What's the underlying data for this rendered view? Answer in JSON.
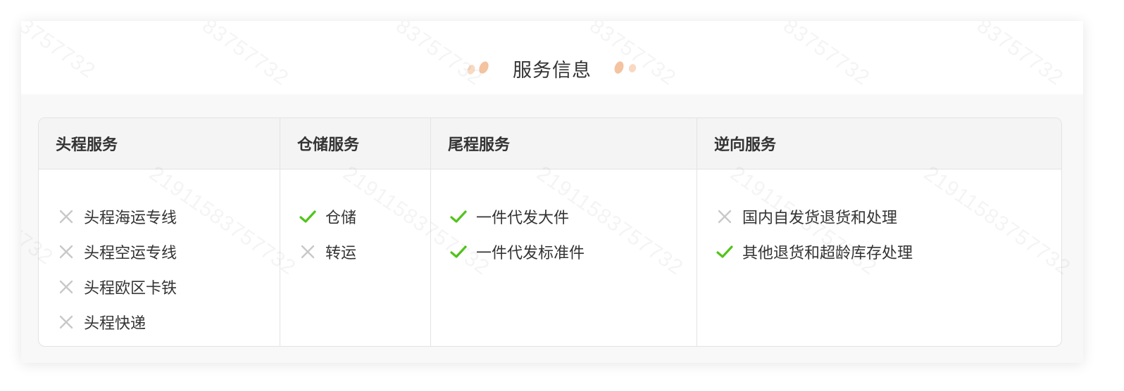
{
  "service_info": {
    "title": "服务信息",
    "columns": [
      {
        "id": "first-leg",
        "header": "头程服务",
        "items": [
          {
            "label": "头程海运专线",
            "status": "unavailable",
            "icon": "cross-icon"
          },
          {
            "label": "头程空运专线",
            "status": "unavailable",
            "icon": "cross-icon"
          },
          {
            "label": "头程欧区卡铁",
            "status": "unavailable",
            "icon": "cross-icon"
          },
          {
            "label": "头程快递",
            "status": "unavailable",
            "icon": "cross-icon"
          }
        ]
      },
      {
        "id": "warehousing",
        "header": "仓储服务",
        "items": [
          {
            "label": "仓储",
            "status": "available",
            "icon": "check-icon"
          },
          {
            "label": "转运",
            "status": "unavailable",
            "icon": "cross-icon"
          }
        ]
      },
      {
        "id": "last-leg",
        "header": "尾程服务",
        "items": [
          {
            "label": "一件代发大件",
            "status": "available",
            "icon": "check-icon"
          },
          {
            "label": "一件代发标准件",
            "status": "available",
            "icon": "check-icon"
          }
        ]
      },
      {
        "id": "reverse",
        "header": "逆向服务",
        "items": [
          {
            "label": "国内自发货退货和处理",
            "status": "unavailable",
            "icon": "cross-icon"
          },
          {
            "label": "其他退货和超龄库存处理",
            "status": "available",
            "icon": "check-icon"
          }
        ]
      }
    ]
  },
  "watermark": {
    "texts": [
      "21911583757732",
      "3757732",
      "83757732"
    ]
  },
  "colors": {
    "check": "#52c41a",
    "cross": "#c8c8c8",
    "deco": "#f2b98e",
    "header_bg": "#f4f4f4",
    "border": "#e3e3e3"
  }
}
